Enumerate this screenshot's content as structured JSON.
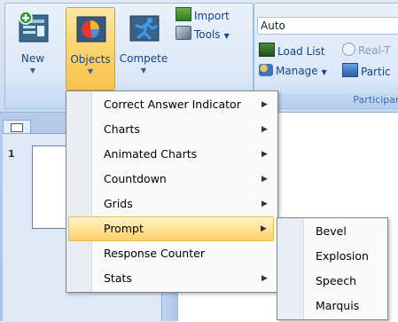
{
  "ribbon": {
    "new_label": "New",
    "objects_label": "Objects",
    "compete_label": "Compete",
    "import_label": "Import",
    "tools_label": "Tools",
    "combo_value": "Auto",
    "load_list_label": "Load List",
    "realtime_label": "Real-T",
    "manage_label": "Manage",
    "partic_label": "Partic",
    "group2_label": "Participan"
  },
  "slides": {
    "thumb_number": "1"
  },
  "menu": {
    "items": [
      {
        "label": "Correct Answer Indicator",
        "has_submenu": true
      },
      {
        "label": "Charts",
        "has_submenu": true
      },
      {
        "label": "Animated Charts",
        "has_submenu": true
      },
      {
        "label": "Countdown",
        "has_submenu": true
      },
      {
        "label": "Grids",
        "has_submenu": true
      },
      {
        "label": "Prompt",
        "has_submenu": true,
        "highlighted": true
      },
      {
        "label": "Response Counter",
        "has_submenu": false
      },
      {
        "label": "Stats",
        "has_submenu": true
      }
    ],
    "submenu_arrow": "▶"
  },
  "submenu": {
    "items": [
      {
        "label": "Bevel"
      },
      {
        "label": "Explosion"
      },
      {
        "label": "Speech"
      },
      {
        "label": "Marquis"
      }
    ]
  },
  "colors": {
    "highlight": "#fbd166",
    "ribbon_text": "#15428b"
  }
}
